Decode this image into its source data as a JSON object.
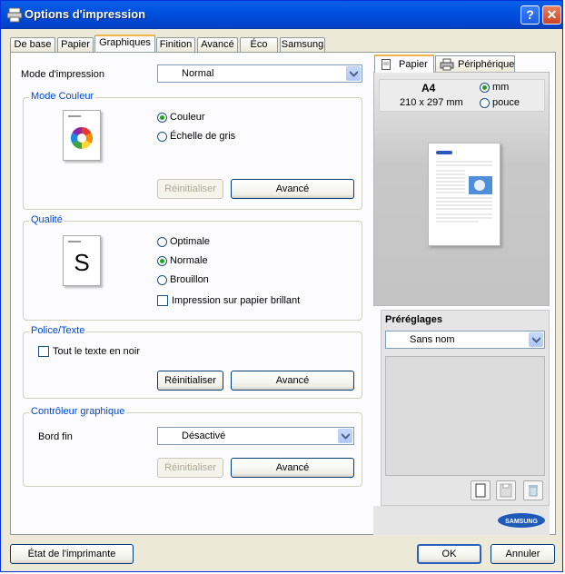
{
  "window": {
    "title": "Options d'impression",
    "help_label": "?",
    "close_label": "✕"
  },
  "tabs": [
    {
      "label": "De base"
    },
    {
      "label": "Papier"
    },
    {
      "label": "Graphiques",
      "active": true
    },
    {
      "label": "Finition"
    },
    {
      "label": "Avancé"
    },
    {
      "label": "Éco"
    },
    {
      "label": "Samsung"
    }
  ],
  "print_mode": {
    "label": "Mode d'impression",
    "value": "Normal"
  },
  "color_mode": {
    "title": "Mode Couleur",
    "options": [
      "Couleur",
      "Échelle de gris"
    ],
    "selected": 0,
    "reset_label": "Réinitialiser",
    "advanced_label": "Avancé"
  },
  "quality": {
    "title": "Qualité",
    "thumbnail_letter": "S",
    "options": [
      "Optimale",
      "Normale",
      "Brouillon"
    ],
    "selected": 1,
    "glossy_label": "Impression sur papier brillant",
    "glossy_checked": false
  },
  "font_text": {
    "title": "Police/Texte",
    "all_black_label": "Tout le texte en noir",
    "all_black_checked": false,
    "reset_label": "Réinitialiser",
    "advanced_label": "Avancé"
  },
  "graphic_controller": {
    "title": "Contrôleur graphique",
    "edge_label": "Bord fin",
    "edge_value": "Désactivé",
    "reset_label": "Réinitialiser",
    "advanced_label": "Avancé"
  },
  "preview_tabs": [
    {
      "label": "Papier",
      "active": true
    },
    {
      "label": "Périphérique"
    }
  ],
  "paper": {
    "size": "A4",
    "dimensions": "210 x 297 mm",
    "units": [
      "mm",
      "pouce"
    ],
    "unit_selected": 0
  },
  "presets": {
    "title": "Préréglages",
    "value": "Sans nom"
  },
  "brand": "SAMSUNG",
  "footer": {
    "printer_status_label": "État de l'imprimante",
    "ok_label": "OK",
    "cancel_label": "Annuler"
  },
  "colors": {
    "title_bar": "#0052e0",
    "group_title": "#0046d5",
    "radio_dot": "#21a121",
    "brand_blue": "#1f5ab8"
  }
}
